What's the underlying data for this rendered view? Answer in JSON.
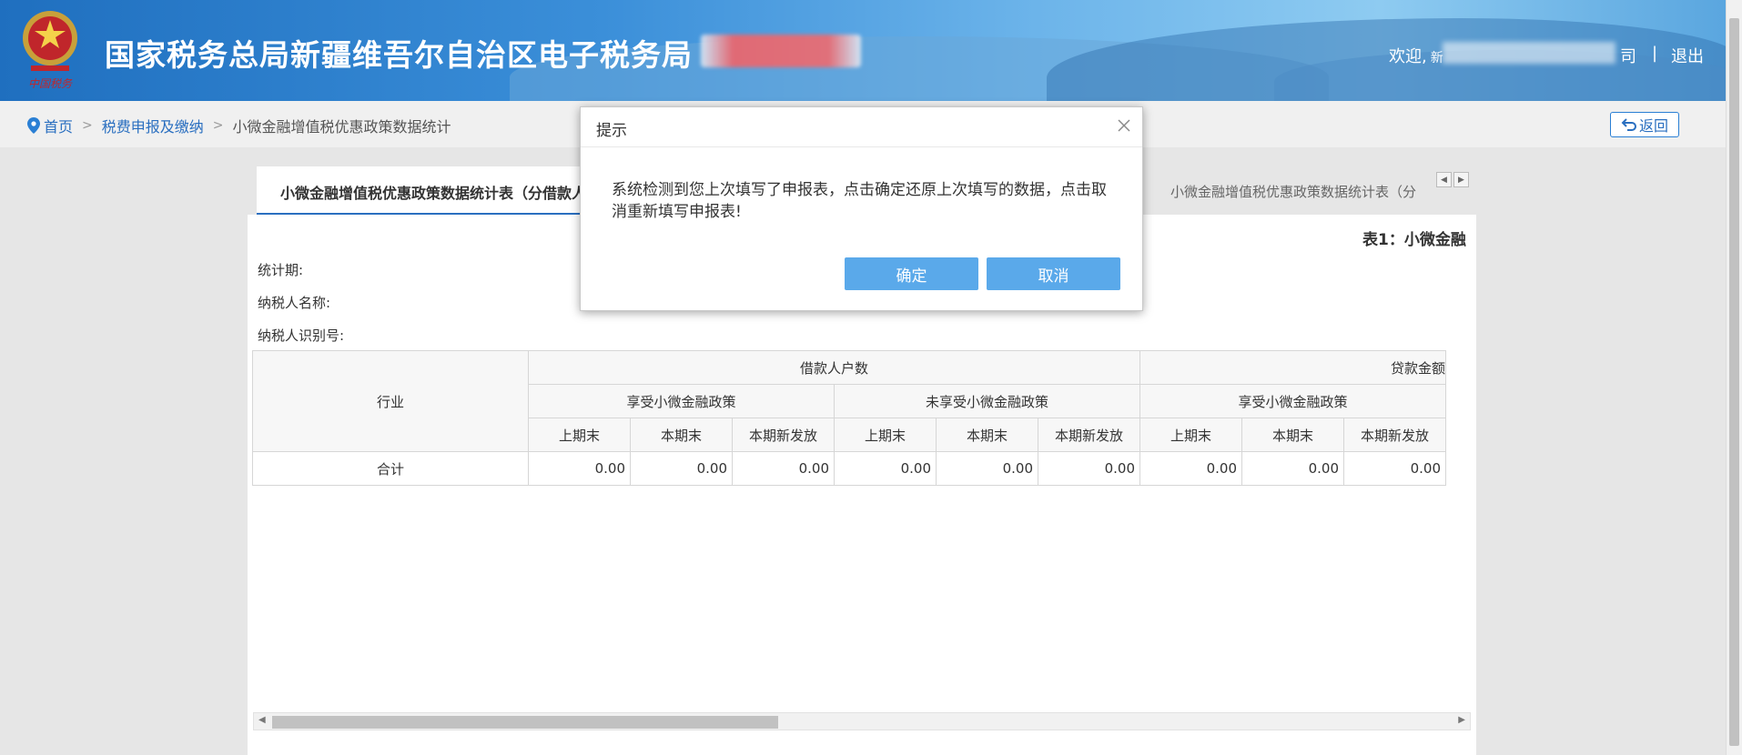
{
  "header": {
    "site_title": "国家税务总局新疆维吾尔自治区电子税务局",
    "welcome_label": "欢迎,",
    "user_initial": "新",
    "user_suffix": "司",
    "separator": "|",
    "logout_label": "退出"
  },
  "breadcrumb": {
    "home": "首页",
    "section": "税费申报及缴纳",
    "current": "小微金融增值税优惠政策数据统计",
    "separator": ">",
    "back_label": "返回"
  },
  "tabs": {
    "active": "小微金融增值税优惠政策数据统计表（分借款人",
    "other": "小微金融增值税优惠政策数据统计表（分"
  },
  "sheet": {
    "title": "表1：小微金融",
    "period_label": "统计期:",
    "taxpayer_name_label": "纳税人名称:",
    "taxpayer_id_label": "纳税人识别号:"
  },
  "table": {
    "industry_header": "行业",
    "group1": "借款人户数",
    "group2": "贷款金额",
    "sub_enjoy": "享受小微金融政策",
    "sub_not_enjoy": "未享受小微金融政策",
    "col_prev_end": "上期末",
    "col_curr_end": "本期末",
    "col_new": "本期新发放",
    "total_label": "合计",
    "values": [
      "0.00",
      "0.00",
      "0.00",
      "0.00",
      "0.00",
      "0.00",
      "0.00",
      "0.00",
      "0.00"
    ]
  },
  "modal": {
    "title": "提示",
    "message": "系统检测到您上次填写了申报表，点击确定还原上次填写的数据，点击取消重新填写申报表!",
    "confirm_label": "确定",
    "cancel_label": "取消"
  },
  "colors": {
    "header_blue": "#1f6fbf",
    "link_blue": "#2a6fc0",
    "button_blue": "#5aa9ea",
    "page_bg": "#e6e6e6"
  }
}
